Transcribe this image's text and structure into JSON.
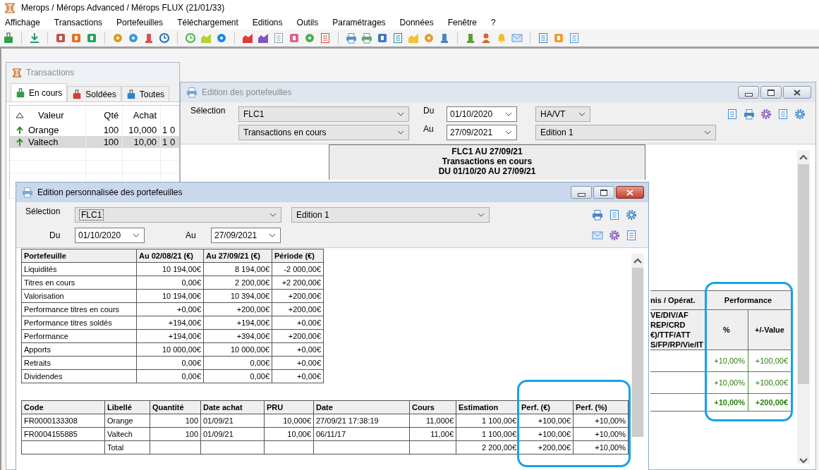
{
  "app": {
    "title": "Merops / Mérops Advanced / Mérops FLUX (21/01/33)",
    "menu": [
      "Affichage",
      "Transactions",
      "Portefeuilles",
      "Téléchargement",
      "Editions",
      "Outils",
      "Paramétrages",
      "Données",
      "Fenêtre",
      "?"
    ]
  },
  "transactions": {
    "title": "Transactions",
    "active": false,
    "tabs": [
      {
        "label": "En cours",
        "selected": true,
        "color": "#2e9e4a"
      },
      {
        "label": "Soldées",
        "selected": false,
        "color": "#d83b2f"
      },
      {
        "label": "Toutes",
        "selected": false,
        "color": "#2f7fd0"
      }
    ],
    "columns": [
      "Valeur",
      "Qté",
      "Achat"
    ],
    "rows": [
      {
        "cells": [
          "Orange",
          "100",
          "10,000",
          "1 0"
        ],
        "selected": false
      },
      {
        "cells": [
          "Valtech",
          "100",
          "10,00",
          "1 0"
        ],
        "selected": true
      }
    ]
  },
  "report": {
    "title": "Edition des portefeuilles",
    "active": false,
    "labels": {
      "selection": "Sélection",
      "du": "Du",
      "au": "Au"
    },
    "selection": "FLC1",
    "type": "Transactions en cours",
    "du": "01/10/2020",
    "au": "27/09/2021",
    "mode": "HA/VT",
    "edition": "Edition 1",
    "heading": [
      "FLC1 AU 27/09/21",
      "Transactions en cours",
      "DU 01/10/20 AU 27/09/21"
    ],
    "table": {
      "column_1": "nis / Opérat.",
      "column_1_lines": [
        "VE/DIV/AF",
        "REP/CRD",
        "€)/TTF/ATT",
        "S/FP/RP/Vie/IT"
      ],
      "group": "Performance",
      "columns": [
        "%",
        "+/-Value"
      ],
      "rows": [
        {
          "cells": [
            "+10,00%",
            "+100,00€"
          ],
          "total": false
        },
        {
          "cells": [
            "+10,00%",
            "+100,00€"
          ],
          "total": false
        },
        {
          "cells": [
            "+10,00%",
            "+200,00€"
          ],
          "total": true
        }
      ]
    }
  },
  "custom": {
    "title": "Edition personnalisée des portefeuilles",
    "active": true,
    "labels": {
      "selection": "Sélection",
      "du": "Du",
      "au": "Au"
    },
    "selection": "FLC1",
    "edition": "Edition 1",
    "du": "01/10/2020",
    "au": "27/09/2021",
    "summary": {
      "columns": [
        "Portefeuille",
        "Au 02/08/21 (€)",
        "Au 27/09/21 (€)",
        "Période (€)"
      ],
      "rows": [
        [
          "Liquidités",
          "10 194,00€",
          "8 194,00€",
          "-2 000,00€"
        ],
        [
          "Titres en cours",
          "0,00€",
          "2 200,00€",
          "+2 200,00€"
        ],
        [
          "Valorisation",
          "10 194,00€",
          "10 394,00€",
          "+200,00€"
        ],
        [
          "Performance titres en cours",
          "+0,00€",
          "+200,00€",
          "+200,00€"
        ],
        [
          "Performance titres soldés",
          "+194,00€",
          "+194,00€",
          "+0,00€"
        ],
        [
          "Performance",
          "+194,00€",
          "+394,00€",
          "+200,00€"
        ],
        [
          "Apports",
          "10 000,00€",
          "10 000,00€",
          "+0,00€"
        ],
        [
          "Retraits",
          "0,00€",
          "0,00€",
          "+0,00€"
        ],
        [
          "Dividendes",
          "0,00€",
          "0,00€",
          "+0,00€"
        ]
      ]
    },
    "detail": {
      "columns": [
        "Code",
        "Libellé",
        "Quantité",
        "Date achat",
        "PRU",
        "Date",
        "Cours",
        "Estimation",
        "Perf. (€)",
        "Perf. (%)"
      ],
      "rows": [
        [
          "FR0000133308",
          "Orange",
          "100",
          "01/09/21",
          "10,000€",
          "27/09/21 17:38:19",
          "11,000€",
          "1 100,00€",
          "+100,00€",
          "+10,00%"
        ],
        [
          "FR0004155885",
          "Valtech",
          "100",
          "01/09/21",
          "10,00€",
          "06/11/17",
          "11,00€",
          "1 100,00€",
          "+100,00€",
          "+10,00%"
        ],
        [
          null,
          "Total",
          null,
          null,
          null,
          null,
          null,
          "2 200,00€",
          "+200,00€",
          "+10,00%"
        ]
      ]
    }
  }
}
